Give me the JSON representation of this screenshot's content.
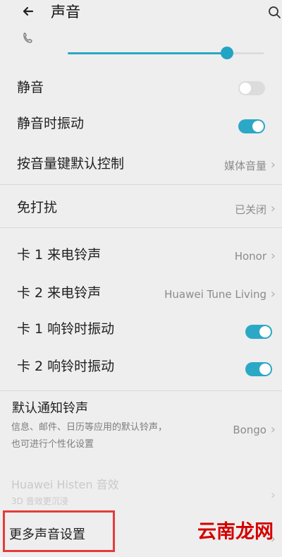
{
  "header": {
    "back_icon": "back-arrow-icon",
    "title": "声音",
    "search_icon": "search-icon"
  },
  "ringtone_volume": {
    "icon": "phone-icon",
    "level_percent": 80,
    "track_color": "#2aa7c3"
  },
  "settings": {
    "mute_label": "静音",
    "mute_toggle": "off",
    "vibrate_on_silent_label": "静音时振动",
    "vibrate_on_silent_toggle": "on",
    "volume_key_default_label": "按音量键默认控制",
    "volume_key_default_value": "媒体音量",
    "do_not_disturb_label": "免打扰",
    "do_not_disturb_value": "已关闭",
    "sim1_ringtone_label": "卡 1 来电铃声",
    "sim1_ringtone_value": "Honor",
    "sim2_ringtone_label": "卡 2 来电铃声",
    "sim2_ringtone_value": "Huawei Tune Living",
    "sim1_vibrate_label": "卡 1 响铃时振动",
    "sim1_vibrate_toggle": "on",
    "sim2_vibrate_label": "卡 2 响铃时振动",
    "sim2_vibrate_toggle": "on",
    "default_notification_label": "默认通知铃声",
    "default_notification_desc_line1": "信息、邮件、日历等应用的默认铃声，",
    "default_notification_desc_line2": "也可进行个性化设置",
    "default_notification_value": "Bongo",
    "histen_label": "Huawei Histen 音效",
    "histen_desc": "3D 音效更沉浸",
    "more_sound_settings_label": "更多声音设置"
  },
  "watermark": "云南龙网",
  "colors": {
    "accent": "#2aa7c3",
    "highlight": "#e53b3b"
  }
}
